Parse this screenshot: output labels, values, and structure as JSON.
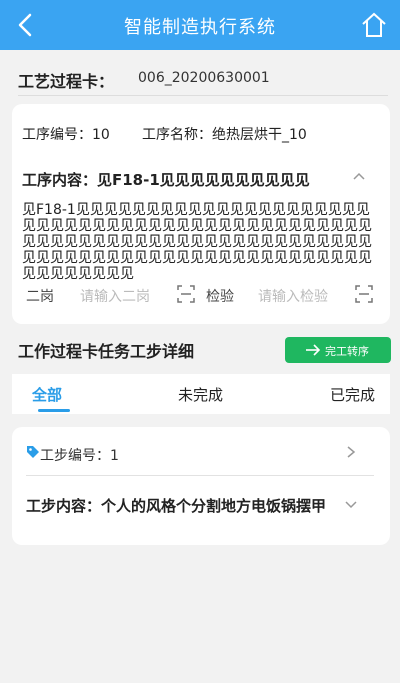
{
  "header": {
    "title": "智能制造执行系统"
  },
  "process_card": {
    "label": "工艺过程卡：",
    "value": "006_20200630001"
  },
  "procedure": {
    "number_label": "工序编号：10",
    "name_label": "工序名称：绝热层烘干_10",
    "content_title": "工序内容：见F18-1见见见见见见见见见见",
    "content_body": "见F18-1见见见见见见见见见见见见见见见见见见见见见见见见见见见见见见见见见见见见见见见见见见见见见见见见见见见见见见见见见见见见见见见见见见见见见见见见见见见见见见见见见见见见见见见见见见见见见见见见见见见见见见见见",
    "second_post_label": "二岗",
    "second_post_placeholder": "请输入二岗",
    "inspect_label": "检验",
    "inspect_placeholder": "请输入检验"
  },
  "section": {
    "title": "工作过程卡任务工步详细",
    "finish_button": "完工转序"
  },
  "tabs": [
    {
      "label": "全部",
      "active": true
    },
    {
      "label": "未完成",
      "active": false
    },
    {
      "label": "已完成",
      "active": false
    }
  ],
  "step": {
    "number_label": "工步编号：1",
    "content": "工步内容：个人的风格个分割地方电饭锅摆甲"
  },
  "colors": {
    "header": "#3aa4f2",
    "accent": "#2a9de8",
    "button": "#1fb760"
  },
  "icons": [
    "back-arrow-icon",
    "home-icon",
    "chevron-up-icon",
    "scan-icon",
    "arrow-right-icon",
    "tag-icon",
    "chevron-right-icon",
    "chevron-down-icon"
  ]
}
